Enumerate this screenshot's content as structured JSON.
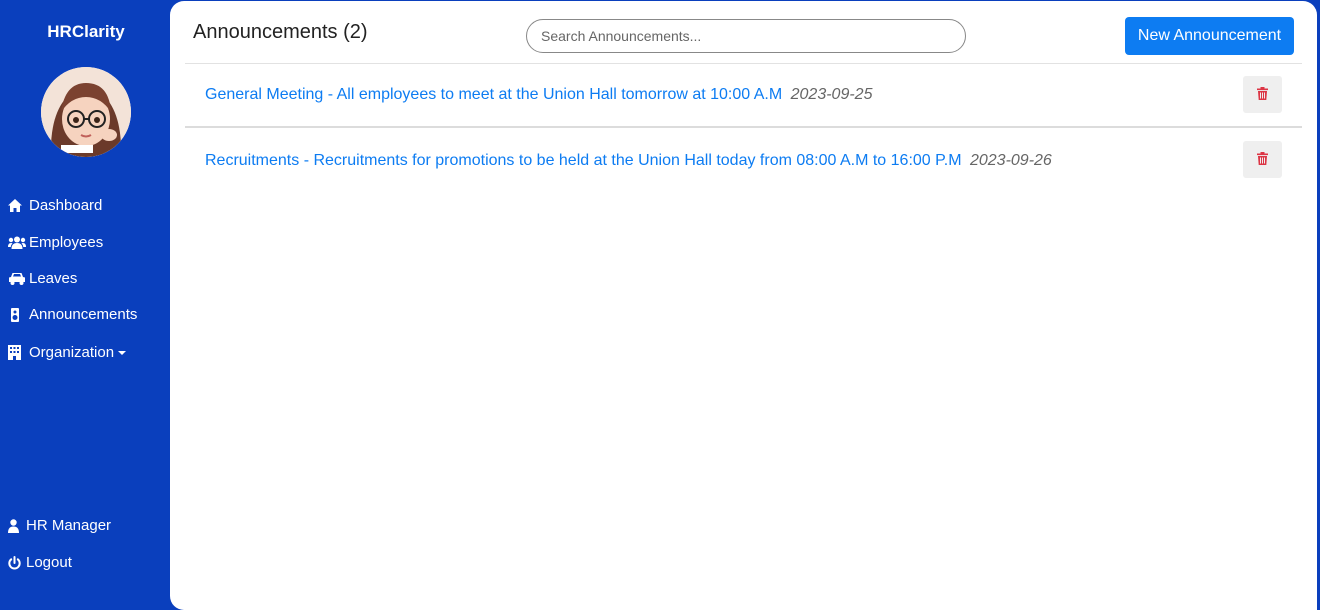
{
  "sidebar": {
    "brand": "HRClarity",
    "nav": [
      {
        "label": "Dashboard",
        "icon": "home-icon"
      },
      {
        "label": "Employees",
        "icon": "users-icon"
      },
      {
        "label": "Leaves",
        "icon": "car-icon"
      },
      {
        "label": "Announcements",
        "icon": "speaker-icon"
      },
      {
        "label": "Organization",
        "icon": "building-icon"
      }
    ],
    "user": {
      "label": "HR Manager",
      "icon": "user-icon"
    },
    "logout": {
      "label": "Logout",
      "icon": "power-icon"
    }
  },
  "header": {
    "title": "Announcements (2)",
    "search_placeholder": "Search Announcements...",
    "new_button": "New Announcement"
  },
  "announcements": [
    {
      "text": "General Meeting - All employees to meet at the Union Hall tomorrow at 10:00 A.M",
      "date": "2023-09-25"
    },
    {
      "text": "Recruitments - Recruitments for promotions to be held at the Union Hall today from 08:00 A.M to 16:00 P.M",
      "date": "2023-09-26"
    }
  ],
  "colors": {
    "sidebar": "#0a3fbd",
    "accent": "#0d7cf2",
    "delete": "#dc3545"
  }
}
